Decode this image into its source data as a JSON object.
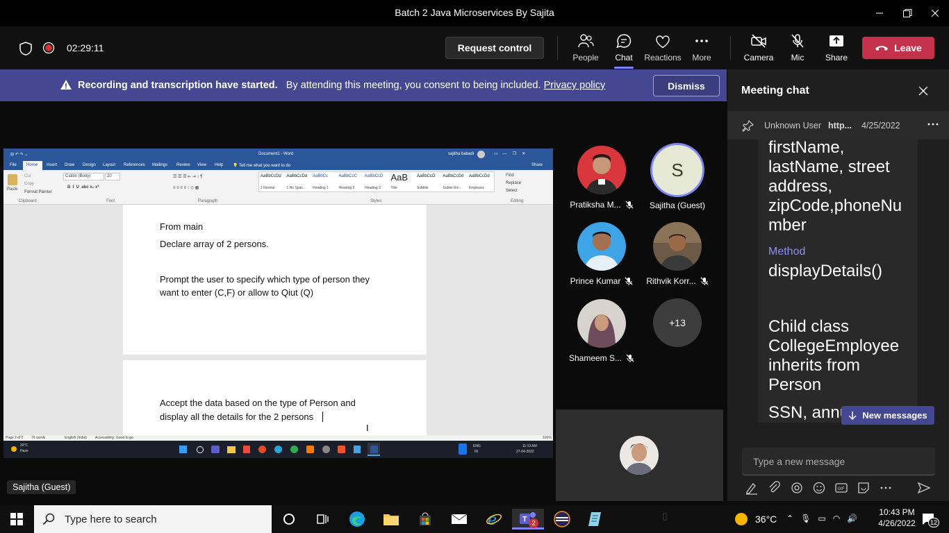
{
  "window": {
    "title": "Batch 2 Java Microservices By Sajita"
  },
  "toolbar": {
    "timer": "02:29:11",
    "request_control": "Request control",
    "people": "People",
    "chat": "Chat",
    "reactions": "Reactions",
    "more": "More",
    "camera": "Camera",
    "mic": "Mic",
    "share": "Share",
    "leave": "Leave",
    "accent": "#7f85f5",
    "leave_color": "#c4314b"
  },
  "banner": {
    "title": "Recording and transcription have started.",
    "text": "By attending this meeting, you consent to being included.",
    "link": "Privacy policy",
    "dismiss": "Dismiss"
  },
  "shared_screen": {
    "word_title": "Document1 - Word",
    "word_user": "sajitha babadi",
    "tabs": [
      "File",
      "Home",
      "Insert",
      "Draw",
      "Design",
      "Layout",
      "References",
      "Mailings",
      "Review",
      "View",
      "Help",
      "Tell me what you want to do"
    ],
    "share_btn": "Share",
    "font_name": "Calibri (Body)",
    "font_size": "20",
    "styles": [
      {
        "sample": "AaBbCcDd",
        "name": "1 Normal"
      },
      {
        "sample": "AaBbCcDd",
        "name": "1 No Spac..."
      },
      {
        "sample": "AaBbCc",
        "name": "Heading 1"
      },
      {
        "sample": "AaBbCcC",
        "name": "Heading 2"
      },
      {
        "sample": "AaBbCcD",
        "name": "Heading 3"
      },
      {
        "sample": "AaB",
        "name": "Title"
      },
      {
        "sample": "AaBbCcD",
        "name": "Subtitle"
      },
      {
        "sample": "AaBbCcDd",
        "name": "Subtle Em..."
      },
      {
        "sample": "AaBbCcDd",
        "name": "Emphasis"
      }
    ],
    "editing": [
      "Find",
      "Replace",
      "Select"
    ],
    "groups": [
      "Clipboard",
      "Font",
      "Paragraph",
      "Styles",
      "Editing"
    ],
    "clipboard": [
      "Paste",
      "Cut",
      "Copy",
      "Format Painter"
    ],
    "doc_lines": [
      "From main",
      "Declare array of 2 persons.",
      "Prompt the user to specify which type of person they",
      "want to enter (C,F) or allow to Qiut (Q)",
      "Accept the data based on the type of Person and",
      "display all the details for  the 2 persons"
    ],
    "status": {
      "page": "Page 2 of 2",
      "words": "76 words",
      "lang": "English (India)",
      "access": "Accessibility: Good to go",
      "zoom": "100%"
    },
    "remote_taskbar": {
      "weather_temp": "32°C",
      "weather": "Haze",
      "lang": "ENG",
      "region": "IN",
      "time": "11:13 AM",
      "date": "27-04-2022"
    },
    "presenter": "Sajitha (Guest)"
  },
  "participants": [
    {
      "name": "Pratiksha M...",
      "muted": true
    },
    {
      "name": "Sajitha (Guest)",
      "initial": "S",
      "muted": false
    },
    {
      "name": "Prince Kumar",
      "muted": true
    },
    {
      "name": "Rithvik Korr...",
      "muted": true
    },
    {
      "name": "Shameem S...",
      "muted": true
    },
    {
      "name": "+13"
    }
  ],
  "chat": {
    "title": "Meeting chat",
    "pinned_user": "Unknown User",
    "pinned_text": "http...",
    "pinned_date": "4/25/2022",
    "message_lines": [
      "firstName,",
      "lastName, street",
      "address,",
      "zipCode,phoneNu",
      "mber"
    ],
    "method_label": "Method",
    "method_name": "displayDetails()",
    "child_lines": [
      "Child class",
      "CollegeEmployee",
      "inherits from",
      "Person"
    ],
    "tail_line": "SSN, annu",
    "new_messages": "New messages",
    "compose_placeholder": "Type a new message"
  },
  "taskbar": {
    "search_placeholder": "Type here to search",
    "temp": "36°C",
    "time": "10:43 PM",
    "date": "4/26/2022",
    "notifications": "12",
    "teams_badge": "2"
  }
}
